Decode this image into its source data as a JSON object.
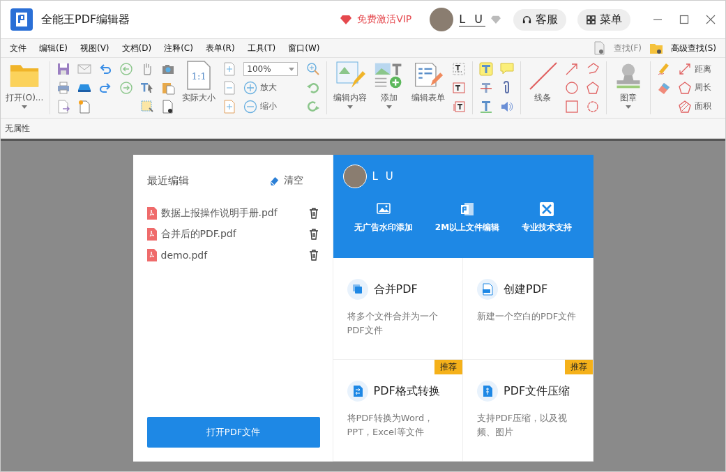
{
  "window": {
    "title": "全能王PDF编辑器",
    "vip": "免费激活VIP",
    "user": "L U",
    "buttons": [
      "客服",
      "菜单"
    ]
  },
  "menu": {
    "items": [
      "文件",
      "编辑(E)",
      "视图(V)",
      "文档(D)",
      "注释(C)",
      "表单(R)",
      "工具(T)",
      "窗口(W)"
    ],
    "find": "查找(F)",
    "advanced_find": "高级查找(S)"
  },
  "toolbar": {
    "open": "打开(O)...",
    "actual_size": "实际大小",
    "actual_size_glyph": "1:1",
    "zoom": "100%",
    "zoom_in": "放大",
    "zoom_out": "缩小",
    "edit_content": "编辑内容",
    "add": "添加",
    "edit_form": "编辑表单",
    "lines": "线条",
    "stamp": "图章",
    "measure": [
      "距离",
      "周长",
      "面积"
    ]
  },
  "properties": "无属性",
  "recent": {
    "title": "最近编辑",
    "clear": "清空",
    "files": [
      "数据上报操作说明手册.pdf",
      "合并后的PDF.pdf",
      "demo.pdf"
    ],
    "open_button": "打开PDF文件"
  },
  "account": {
    "name": "L U",
    "features": [
      {
        "kind": "image",
        "label": "无广告水印添加"
      },
      {
        "kind": "document",
        "label": "2M以上文件编辑"
      },
      {
        "kind": "tools",
        "label": "专业技术支持"
      }
    ]
  },
  "cards": [
    {
      "kind": "merge",
      "title": "合并PDF",
      "description": "将多个文件合并为一个PDF文件"
    },
    {
      "kind": "create",
      "title": "创建PDF",
      "description": "新建一个空白的PDF文件"
    },
    {
      "kind": "convert",
      "title": "PDF格式转换",
      "description": "将PDF转换为Word，PPT，Excel等文件",
      "badge": "推荐"
    },
    {
      "kind": "compress",
      "title": "PDF文件压缩",
      "description": "支持PDF压缩，以及视频、图片",
      "badge": "推荐"
    }
  ]
}
